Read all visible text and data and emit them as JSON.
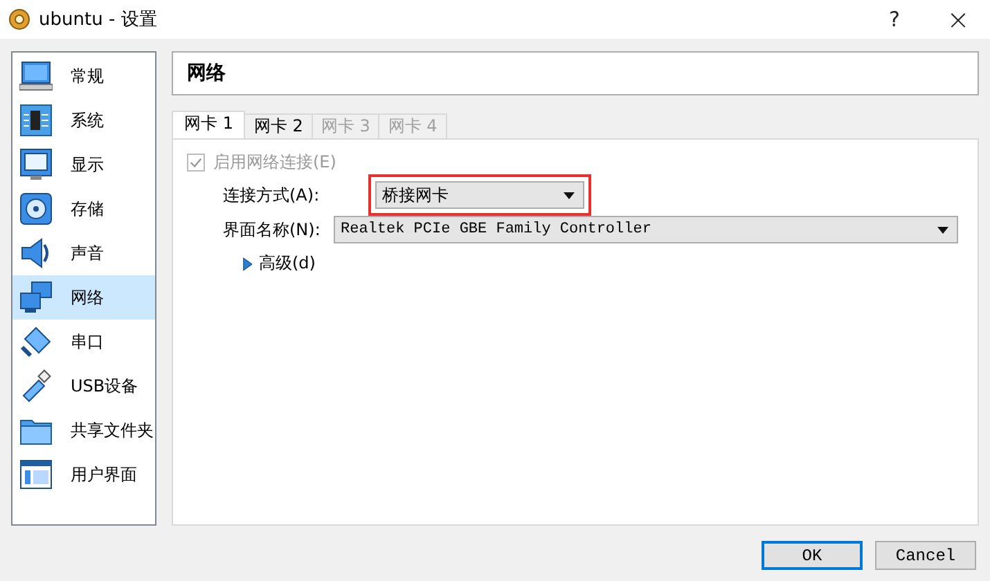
{
  "window": {
    "title": "ubuntu - 设置",
    "help": "?",
    "close": "×"
  },
  "sidebar": {
    "items": [
      {
        "label": "常规",
        "selected": false
      },
      {
        "label": "系统",
        "selected": false
      },
      {
        "label": "显示",
        "selected": false
      },
      {
        "label": "存储",
        "selected": false
      },
      {
        "label": "声音",
        "selected": false
      },
      {
        "label": "网络",
        "selected": true
      },
      {
        "label": "串口",
        "selected": false
      },
      {
        "label": "USB设备",
        "selected": false
      },
      {
        "label": "共享文件夹",
        "selected": false
      },
      {
        "label": "用户界面",
        "selected": false
      }
    ]
  },
  "page_title": "网络",
  "tabs": [
    {
      "label": "网卡 1",
      "selected": true,
      "disabled": false
    },
    {
      "label": "网卡 2",
      "selected": false,
      "disabled": false
    },
    {
      "label": "网卡 3",
      "selected": false,
      "disabled": true
    },
    {
      "label": "网卡 4",
      "selected": false,
      "disabled": true
    }
  ],
  "enable_checkbox": {
    "label": "启用网络连接(E)",
    "checked": true,
    "disabled": true
  },
  "fields": [
    {
      "label": "连接方式(A):",
      "value": "桥接网卡",
      "highlighted": true
    },
    {
      "label": "界面名称(N):",
      "value": "Realtek PCIe GBE Family Controller",
      "highlighted": false
    }
  ],
  "advanced": {
    "label": "高级(d)",
    "expanded": false
  },
  "buttons": [
    {
      "label": "OK",
      "default": true
    },
    {
      "label": "Cancel",
      "default": false
    }
  ]
}
